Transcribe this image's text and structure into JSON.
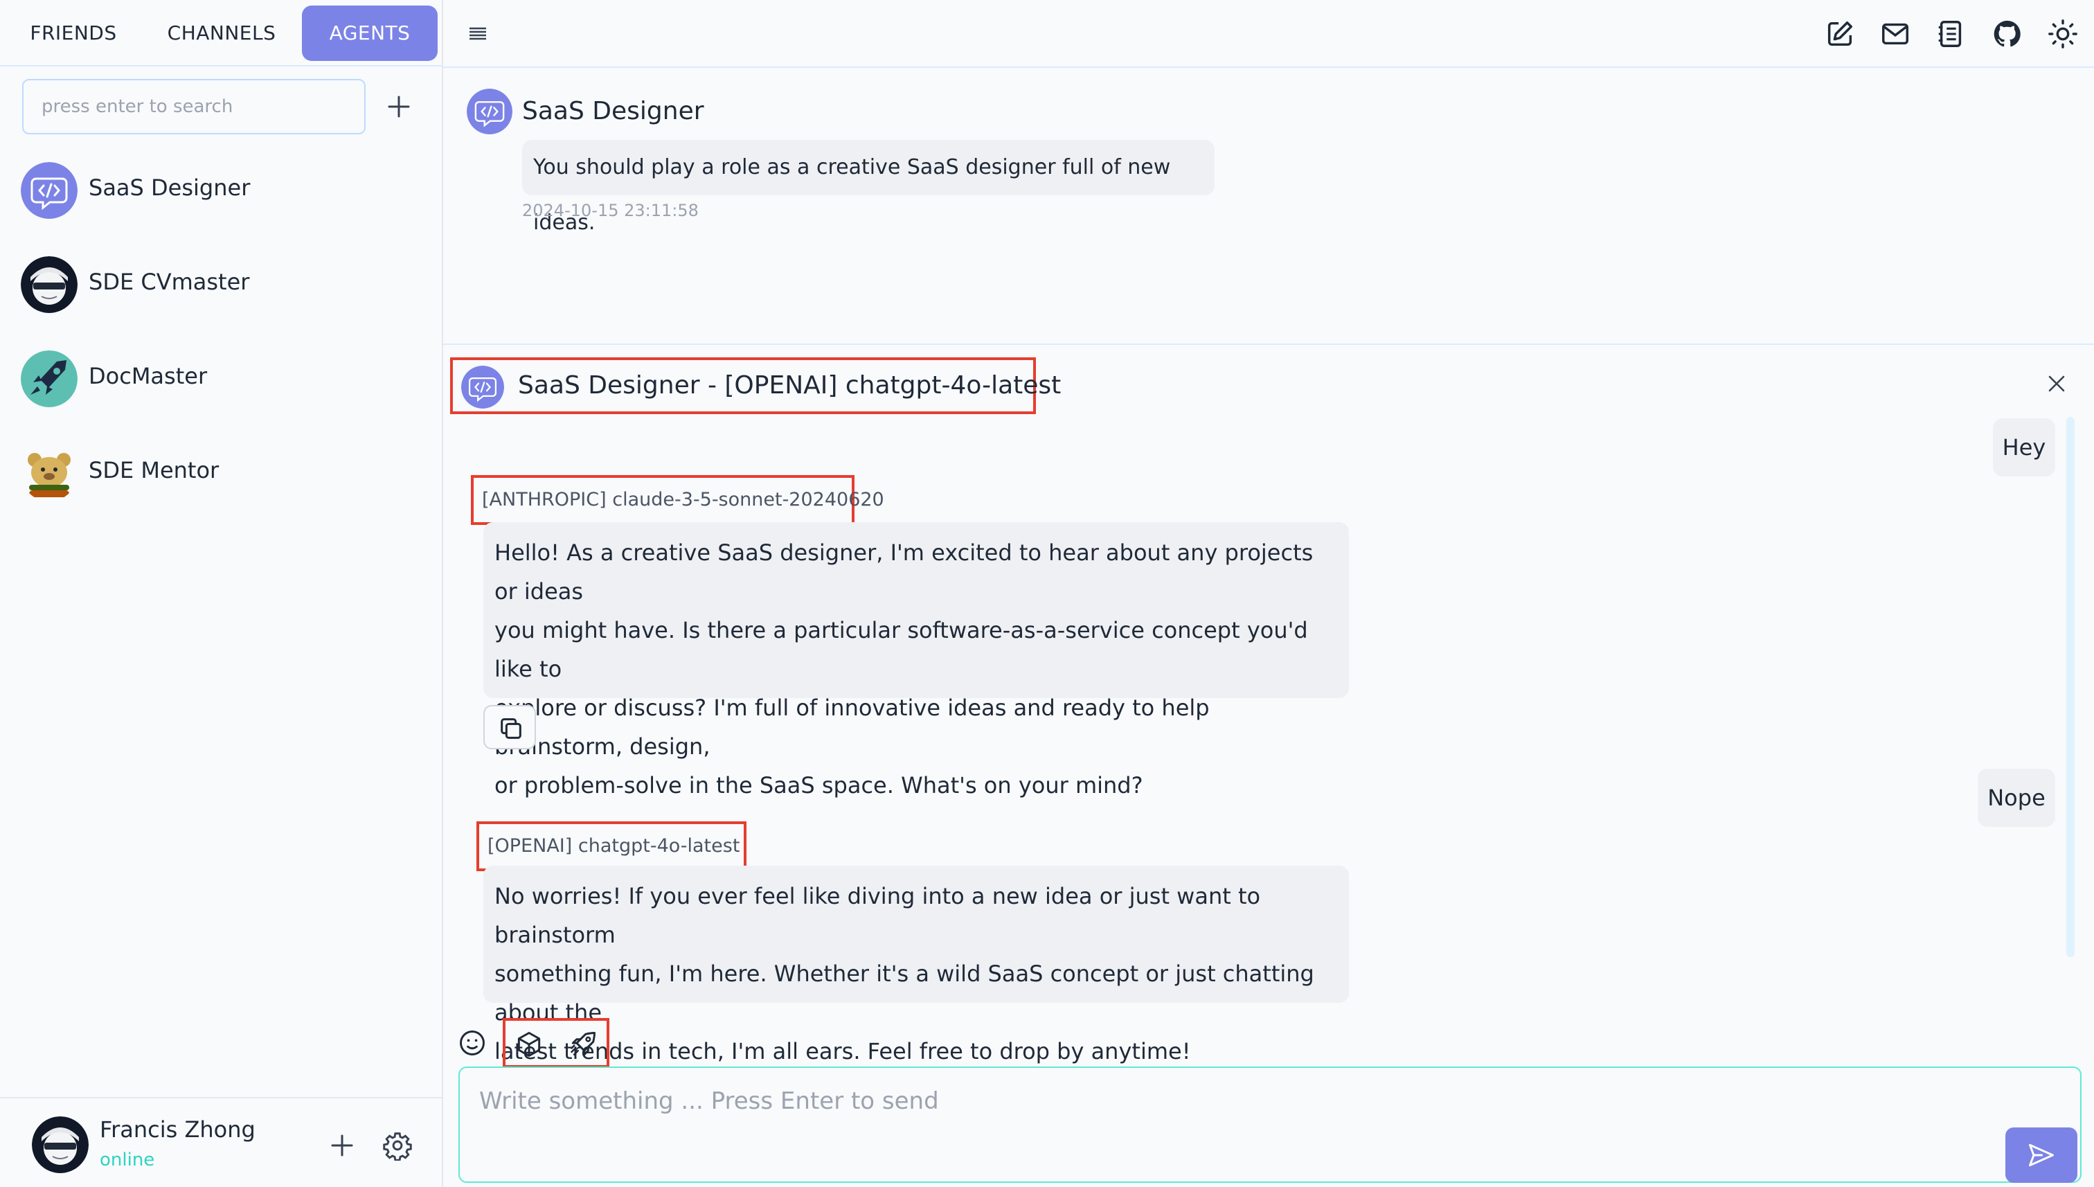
{
  "tabs": [
    {
      "label": "FRIENDS"
    },
    {
      "label": "CHANNELS"
    },
    {
      "label": "AGENTS"
    }
  ],
  "search": {
    "placeholder": "press enter to search"
  },
  "agents": [
    {
      "name": "SaaS Designer"
    },
    {
      "name": "SDE CVmaster"
    },
    {
      "name": "DocMaster"
    },
    {
      "name": "SDE Mentor"
    }
  ],
  "profile": {
    "name": "Francis Zhong",
    "status": "online"
  },
  "topbar": {
    "icons": [
      "edit-icon",
      "mail-icon",
      "notebook-icon",
      "github-icon",
      "sun-icon"
    ]
  },
  "system": {
    "title": "SaaS Designer",
    "prompt": "You should play a role as a creative SaaS designer full of new ideas.",
    "timestamp": "2024-10-15 23:11:58"
  },
  "chat": {
    "header": "SaaS Designer - [OPENAI] chatgpt-4o-latest",
    "messages": [
      {
        "role": "user",
        "text": "Hey"
      },
      {
        "role": "assistant",
        "model": "[ANTHROPIC] claude-3-5-sonnet-20240620",
        "lines": [
          "Hello! As a creative SaaS designer, I'm excited to hear about any projects or ideas",
          "you might have. Is there a particular software-as-a-service concept you'd like to",
          "explore or discuss? I'm full of innovative ideas and ready to help brainstorm, design,",
          "or problem-solve in the SaaS space. What's on your mind?"
        ]
      },
      {
        "role": "user",
        "text": "Nope"
      },
      {
        "role": "assistant",
        "model": "[OPENAI] chatgpt-4o-latest",
        "lines": [
          "No worries! If you ever feel like diving into a new idea or just want to brainstorm",
          "something fun, I'm here. Whether it's a wild SaaS concept or just chatting about the",
          "latest trends in tech, I'm all ears. Feel free to drop by anytime!"
        ]
      }
    ],
    "composer_placeholder": "Write something ... Press Enter to send"
  },
  "colors": {
    "accent": "#7c83e6",
    "highlight": "#e53e2f",
    "online": "#2dd4bf"
  }
}
